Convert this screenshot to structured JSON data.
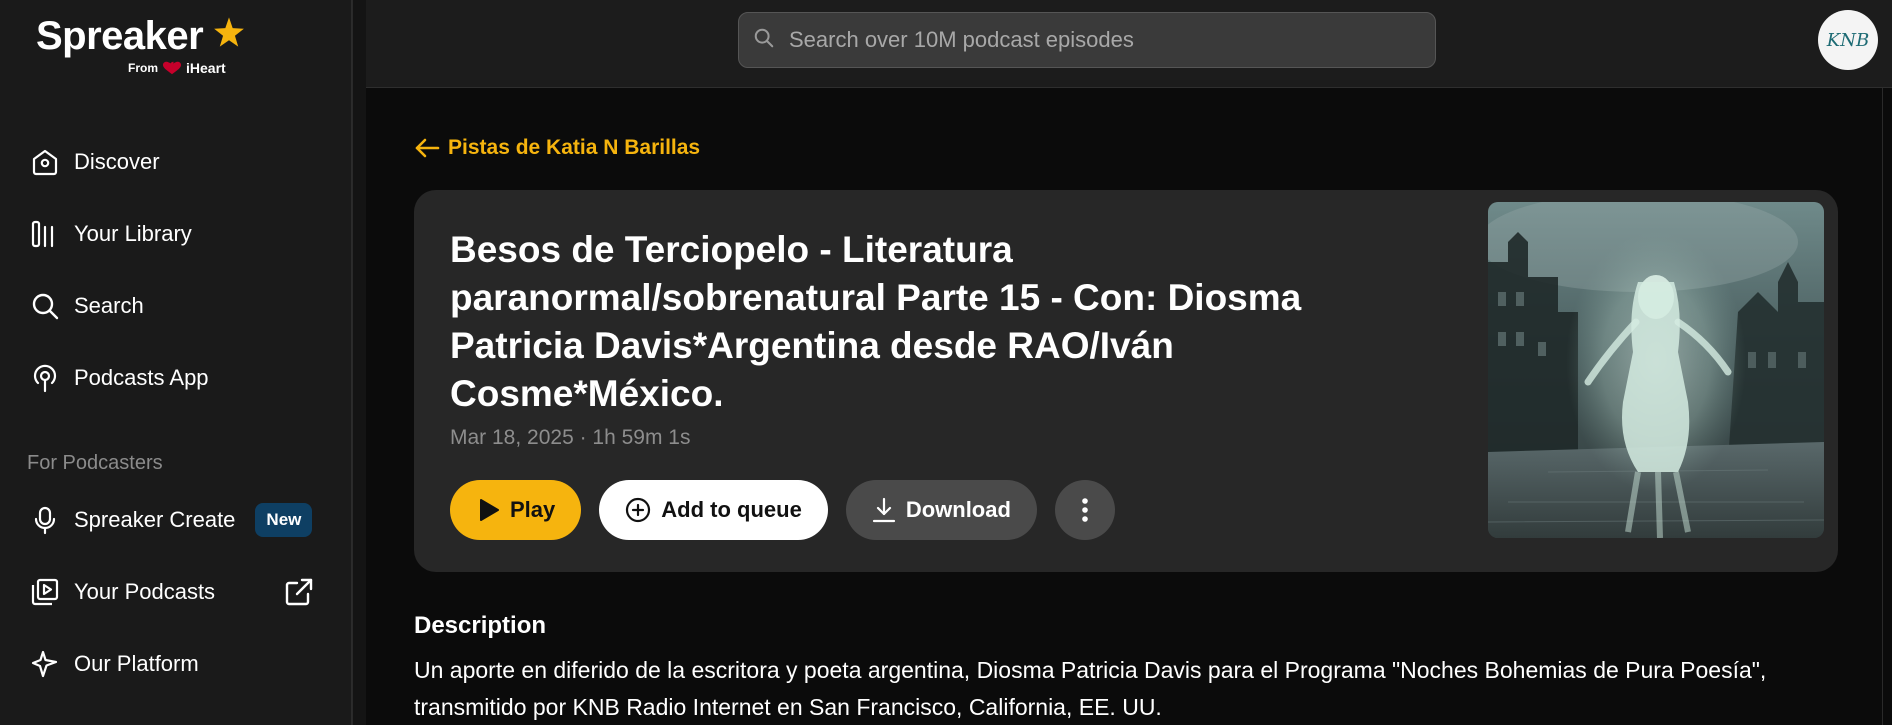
{
  "brand": {
    "name": "Spreaker",
    "from_label": "From",
    "partner": "iHeart",
    "accent_color": "#f6b40e"
  },
  "sidebar": {
    "items": [
      {
        "label": "Discover",
        "icon": "home-icon"
      },
      {
        "label": "Your Library",
        "icon": "library-icon"
      },
      {
        "label": "Search",
        "icon": "search-icon"
      },
      {
        "label": "Podcasts App",
        "icon": "podcasts-app-icon"
      }
    ],
    "section_label": "For Podcasters",
    "podcaster_items": [
      {
        "label": "Spreaker Create",
        "icon": "microphone-icon",
        "badge": "New"
      },
      {
        "label": "Your Podcasts",
        "icon": "podcast-play-icon",
        "trailing_icon": "external-link-icon"
      },
      {
        "label": "Our Platform",
        "icon": "sparkle-icon"
      }
    ]
  },
  "header": {
    "search_placeholder": "Search over 10M podcast episodes",
    "avatar_text": "KNB"
  },
  "episode": {
    "back_label": "Pistas de Katia N Barillas",
    "title": "Besos de Terciopelo - Literatura paranormal/sobrenatural Parte 15 - Con: Diosma Patricia Davis*Argentina desde RAO/Iván Cosme*México.",
    "meta": "Mar 18, 2025 · 1h 59m 1s",
    "actions": {
      "play": "Play",
      "queue": "Add to queue",
      "download": "Download"
    },
    "description_heading": "Description",
    "description": "Un aporte en diferido de la escritora y poeta argentina, Diosma Patricia Davis para el Programa \"Noches Bohemias de Pura Poesía\", transmitido por KNB Radio Internet en San Francisco, California, EE. UU."
  }
}
